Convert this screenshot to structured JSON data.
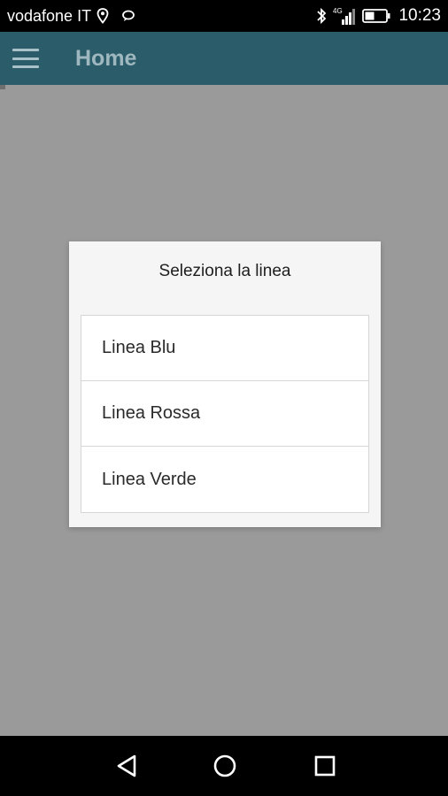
{
  "status_bar": {
    "carrier": "vodafone IT",
    "time": "10:23",
    "icons": [
      "location-icon",
      "message-icon",
      "bluetooth-icon",
      "signal-icon",
      "battery-icon"
    ]
  },
  "app_bar": {
    "title": "Home",
    "menu_icon": "hamburger-menu-icon"
  },
  "dialog": {
    "title": "Seleziona la linea",
    "options": [
      {
        "label": "Linea Blu"
      },
      {
        "label": "Linea Rossa"
      },
      {
        "label": "Linea Verde"
      }
    ]
  },
  "nav_bar": {
    "icons": [
      "back-icon",
      "home-icon",
      "recents-icon"
    ]
  },
  "colors": {
    "app_bar": "#2b5c6a",
    "scrim": "#9a9a9a",
    "dialog_bg": "#f5f5f5"
  }
}
